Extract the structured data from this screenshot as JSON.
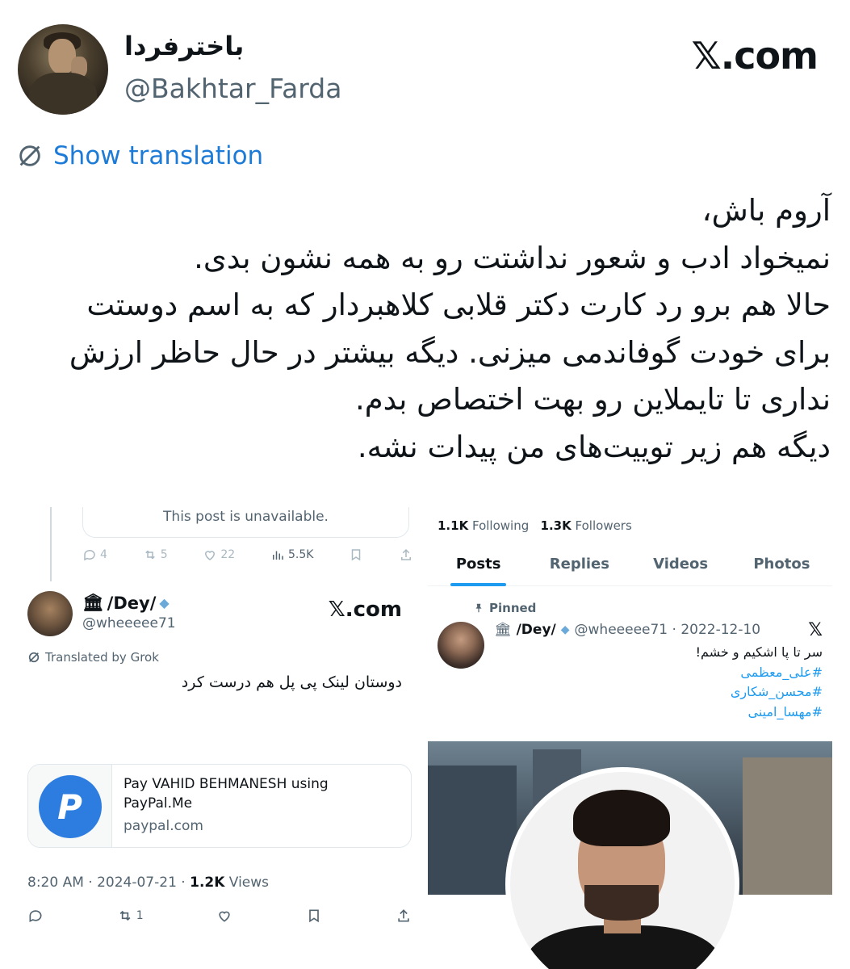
{
  "header": {
    "display_name": "باخترفردا",
    "handle": "@Bakhtar_Farda",
    "brand": "𝕏.com"
  },
  "translate": {
    "label": "Show translation"
  },
  "tweet": {
    "lines": [
      "آروم باش،",
      "نمیخواد ادب و شعور نداشتت رو به همه نشون بدی.",
      "حالا هم برو رد کارت دکتر قلابی کلاهبردار که به اسم دوستت",
      "برای خودت گوفاندمی میزنی. دیگه بیشتر در حال حاظر ارزش",
      "نداری تا تایملاین رو بهت اختصاص بدم.",
      "دیگه هم زیر توییت‌های من پیدات نشه."
    ]
  },
  "left_shot": {
    "unavailable": "This post is unavailable.",
    "mini_actions": {
      "replies": "4",
      "reposts": "5",
      "likes": "22",
      "views": "5.5K"
    },
    "author": {
      "name": "/Dey/",
      "handle": "@wheeeee71"
    },
    "brand": "𝕏.com",
    "translated": "Translated by Grok",
    "text": "دوستان لینک پی پل هم درست کرد",
    "card": {
      "title": "Pay VAHID BEHMANESH using PayPal.Me",
      "domain": "paypal.com",
      "logo": "P"
    },
    "meta": {
      "time": "8:20 AM · 2024-07-21 · ",
      "views_count": "1.2K",
      "views_label": " Views"
    },
    "actions": {
      "reposts": "1"
    }
  },
  "right_shot": {
    "following_count": "1.1K",
    "following_label": "Following",
    "followers_count": "1.3K",
    "followers_label": "Followers",
    "tabs": [
      "Posts",
      "Replies",
      "Videos",
      "Photos"
    ],
    "pinned": "Pinned",
    "post": {
      "name": "/Dey/",
      "handle_date": "@wheeeee71 · 2022-12-10",
      "x": "𝕏",
      "text": "سر تا پا اشکیم و خشم!",
      "hashtags": [
        "#علی_معظمی",
        "#محسن_شکاری",
        "#مهسا_امینی"
      ]
    }
  },
  "colors": {
    "link": "#1d7bd8",
    "accent": "#1d9bf0",
    "muted": "#536471"
  }
}
